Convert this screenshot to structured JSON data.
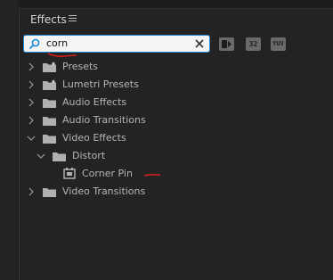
{
  "panel": {
    "title": "Effects"
  },
  "search": {
    "value": "corn",
    "placeholder": ""
  },
  "toolbar": {
    "accelerated_label": "",
    "bit32_label": "32",
    "yuv_label": "YUV"
  },
  "tree": {
    "presets": "Presets",
    "lumetri_presets": "Lumetri Presets",
    "audio_effects": "Audio Effects",
    "audio_transitions": "Audio Transitions",
    "video_effects": "Video Effects",
    "distort": "Distort",
    "corner_pin": "Corner Pin",
    "video_transitions": "Video Transitions"
  },
  "colors": {
    "accent": "#1f8ad6",
    "annotation": "#d42020"
  }
}
